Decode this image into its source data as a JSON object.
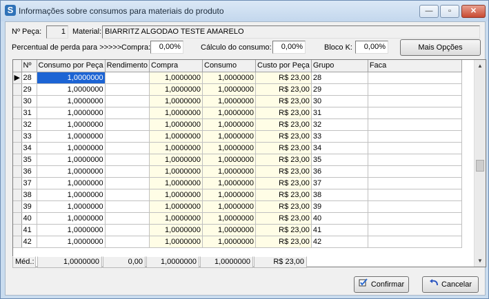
{
  "window": {
    "title": "Informações sobre consumos para materiais do produto",
    "app_icon": "S",
    "controls": {
      "minimize": "—",
      "maximize": "▫",
      "close": "✕"
    }
  },
  "header": {
    "peca_label": "Nº Peça:",
    "peca_value": "1",
    "material_label": "Material:",
    "material_value": "BIARRITZ ALGODAO TESTE AMARELO",
    "perda_label": "Percentual de perda para >>>>>",
    "compra_label": "Compra:",
    "compra_value": "0,00%",
    "calculo_label": "Cálculo do consumo:",
    "calculo_value": "0,00%",
    "bloco_label": "Bloco K:",
    "bloco_value": "0,00%",
    "mais_opcoes": "Mais Opções"
  },
  "grid": {
    "columns": [
      "Nº",
      "Consumo por Peça",
      "Rendimento",
      "Compra",
      "Consumo",
      "Custo por Peça",
      "Grupo",
      "Faca"
    ],
    "rows": [
      [
        "28",
        "1,0000000",
        "",
        "1,0000000",
        "1,0000000",
        "R$ 23,00",
        "28",
        ""
      ],
      [
        "29",
        "1,0000000",
        "",
        "1,0000000",
        "1,0000000",
        "R$ 23,00",
        "29",
        ""
      ],
      [
        "30",
        "1,0000000",
        "",
        "1,0000000",
        "1,0000000",
        "R$ 23,00",
        "30",
        ""
      ],
      [
        "31",
        "1,0000000",
        "",
        "1,0000000",
        "1,0000000",
        "R$ 23,00",
        "31",
        ""
      ],
      [
        "32",
        "1,0000000",
        "",
        "1,0000000",
        "1,0000000",
        "R$ 23,00",
        "32",
        ""
      ],
      [
        "33",
        "1,0000000",
        "",
        "1,0000000",
        "1,0000000",
        "R$ 23,00",
        "33",
        ""
      ],
      [
        "34",
        "1,0000000",
        "",
        "1,0000000",
        "1,0000000",
        "R$ 23,00",
        "34",
        ""
      ],
      [
        "35",
        "1,0000000",
        "",
        "1,0000000",
        "1,0000000",
        "R$ 23,00",
        "35",
        ""
      ],
      [
        "36",
        "1,0000000",
        "",
        "1,0000000",
        "1,0000000",
        "R$ 23,00",
        "36",
        ""
      ],
      [
        "37",
        "1,0000000",
        "",
        "1,0000000",
        "1,0000000",
        "R$ 23,00",
        "37",
        ""
      ],
      [
        "38",
        "1,0000000",
        "",
        "1,0000000",
        "1,0000000",
        "R$ 23,00",
        "38",
        ""
      ],
      [
        "39",
        "1,0000000",
        "",
        "1,0000000",
        "1,0000000",
        "R$ 23,00",
        "39",
        ""
      ],
      [
        "40",
        "1,0000000",
        "",
        "1,0000000",
        "1,0000000",
        "R$ 23,00",
        "40",
        ""
      ],
      [
        "41",
        "1,0000000",
        "",
        "1,0000000",
        "1,0000000",
        "R$ 23,00",
        "41",
        ""
      ],
      [
        "42",
        "1,0000000",
        "",
        "1,0000000",
        "1,0000000",
        "R$ 23,00",
        "42",
        ""
      ]
    ],
    "selected_row_indicator": "▶",
    "scroll_up": "▲",
    "scroll_down": "▼"
  },
  "footer": {
    "label": "Méd.:",
    "consumo_peca": "1,0000000",
    "rendimento": "0,00",
    "compra": "1,0000000",
    "consumo": "1,0000000",
    "custo": "R$ 23,00"
  },
  "buttons": {
    "confirmar": "Confirmar",
    "cancelar": "Cancelar"
  },
  "colors": {
    "selection": "#1c64d4",
    "highlight_column": "#fffde6"
  }
}
